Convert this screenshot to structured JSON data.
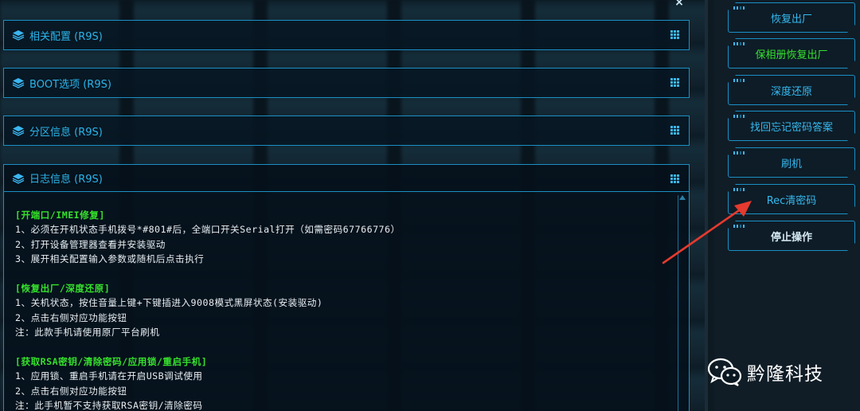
{
  "close_glyph": "×",
  "panels": [
    {
      "title": "相关配置 (R9S)"
    },
    {
      "title": "BOOT选项 (R9S)"
    },
    {
      "title": "分区信息 (R9S)"
    }
  ],
  "log": {
    "title": "日志信息 (R9S)",
    "sections": [
      {
        "heading": "[开端口/IMEI修复]",
        "lines": [
          "1、必须在开机状态手机拨号*#801#后，全端口开关Serial打开（如需密码67766776）",
          "2、打开设备管理器查看并安装驱动",
          "3、展开相关配置输入参数或随机后点击执行"
        ]
      },
      {
        "heading": "[恢复出厂/深度还原]",
        "lines": [
          "1、关机状态，按住音量上键+下键插进入9008模式黑屏状态(安装驱动)",
          "2、点击右侧对应功能按钮",
          "注：此款手机请使用原厂平台刷机"
        ]
      },
      {
        "heading": "[获取RSA密钥/清除密码/应用锁/重启手机]",
        "lines": [
          "1、应用锁、重启手机请在开启USB调试使用",
          "2、点击右侧对应功能按钮",
          "注：此手机暂不支持获取RSA密钥/清除密码"
        ]
      }
    ]
  },
  "sidebar": {
    "buttons": [
      {
        "label": "恢复出厂",
        "style": "normal"
      },
      {
        "label": "保相册恢复出厂",
        "style": "green"
      },
      {
        "label": "深度还原",
        "style": "normal"
      },
      {
        "label": "找回忘记密码答案",
        "style": "normal"
      },
      {
        "label": "刷机",
        "style": "normal"
      },
      {
        "label": "Rec清密码",
        "style": "normal"
      },
      {
        "label": "停止操作",
        "style": "bold"
      }
    ]
  },
  "watermark": {
    "text": "黔隆科技"
  },
  "colors": {
    "accent": "#1b8fc4",
    "heading_green": "#35e02b",
    "arrow_red": "#e53a2f"
  }
}
